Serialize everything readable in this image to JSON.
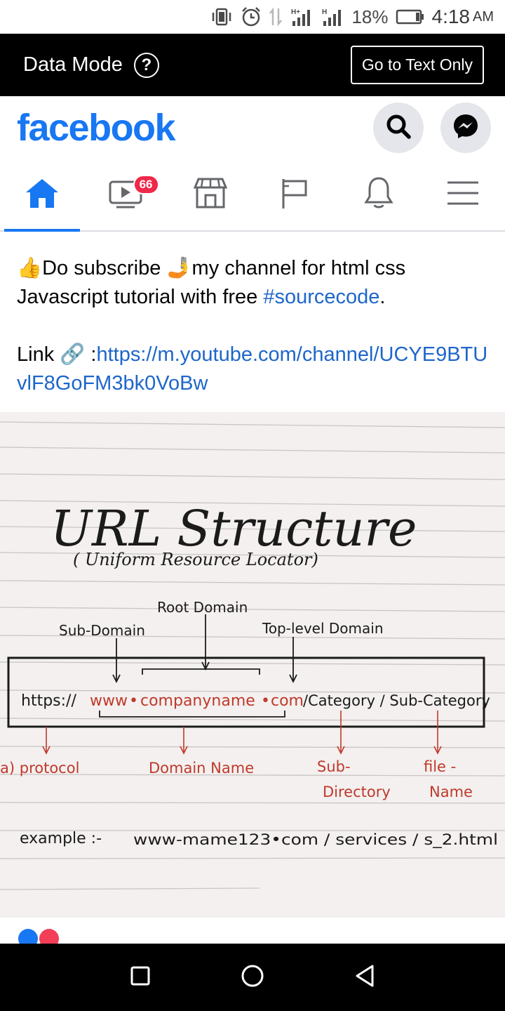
{
  "status_bar": {
    "battery_percent": "18%",
    "time": "4:18",
    "ampm": "AM",
    "icons": [
      "vibrate-icon",
      "alarm-icon",
      "data-transfer-icon",
      "signal-h-plus-icon",
      "signal-h-icon",
      "battery-icon"
    ]
  },
  "data_mode_bar": {
    "label": "Data Mode",
    "help_symbol": "?",
    "text_only_button": "Go to Text Only"
  },
  "header": {
    "logo": "facebook",
    "brand_color": "#1877f2"
  },
  "nav": {
    "items": [
      {
        "name": "home",
        "active": true
      },
      {
        "name": "watch",
        "badge": "66"
      },
      {
        "name": "marketplace"
      },
      {
        "name": "pages"
      },
      {
        "name": "notifications"
      },
      {
        "name": "menu"
      }
    ]
  },
  "post": {
    "line1_emoji": "👍",
    "line1_text_a": "Do subscribe ",
    "line1_emoji2": "🤳",
    "line1_text_b": "my channel for html css Javascript tutorial with free ",
    "hashtag": "#sourcecode",
    "line1_end": ".",
    "link_label": "Link ",
    "link_emoji": "🔗",
    "link_sep": " :",
    "link_url": "https://m.youtube.com/channel/UCYE9BTUvlF8GoFM3bk0VoBw"
  },
  "image": {
    "title": "URL Structure",
    "subtitle": "( Uniform Resource Locator)",
    "top_labels": {
      "sub_domain": "Sub-Domain",
      "root_domain": "Root Domain",
      "top_level": "Top-level Domain"
    },
    "url_parts": {
      "protocol": "https://",
      "sub": "www",
      "dot1": "•",
      "domain": "companyname",
      "dot2": "•",
      "tld": "com",
      "path": "/Category / Sub-Category"
    },
    "bottom_labels": {
      "protocol": "a) protocol",
      "domain_name": "Domain Name",
      "sub_dir_1": "Sub-",
      "sub_dir_2": "Directory",
      "file_1": "file -",
      "file_2": "Name"
    },
    "example_label": "example :-",
    "example_value": "www-mame123•com / services / s_2.html",
    "ink_color": "#1b1b1b",
    "red_ink_color": "#c0392b"
  }
}
